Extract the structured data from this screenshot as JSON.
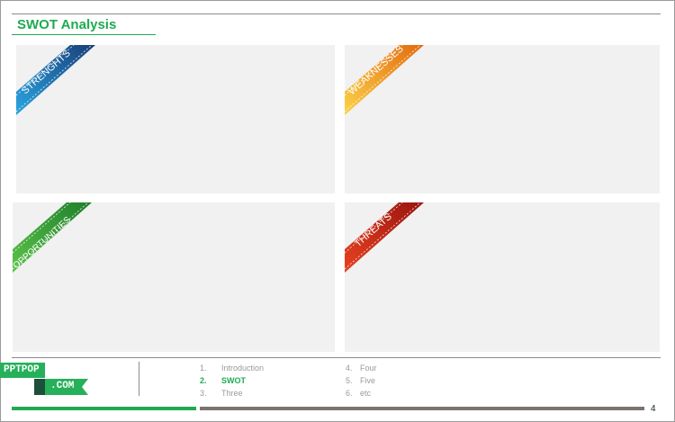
{
  "title": "SWOT Analysis",
  "quadrants": [
    {
      "label": "STRENGHTS",
      "color": "#1e8fd0",
      "dark": "#1a3f7a"
    },
    {
      "label": "WEAKNESSES",
      "color": "#f4a620",
      "dark": "#e36b10"
    },
    {
      "label": "OPPORTUNITIES",
      "color": "#3fae3a",
      "dark": "#1f7f2a"
    },
    {
      "label": "THREATS",
      "color": "#d42a1a",
      "dark": "#9a1410"
    }
  ],
  "logo": {
    "top": "PPTPOP",
    "bottom": ".COM"
  },
  "nav": {
    "left": [
      {
        "num": "1.",
        "label": "Introduction",
        "active": false
      },
      {
        "num": "2.",
        "label": "SWOT",
        "active": true
      },
      {
        "num": "3.",
        "label": "Three",
        "active": false
      }
    ],
    "right": [
      {
        "num": "4.",
        "label": "Four",
        "active": false
      },
      {
        "num": "5.",
        "label": "Five",
        "active": false
      },
      {
        "num": "6.",
        "label": "etc",
        "active": false
      }
    ]
  },
  "page_number": "4"
}
